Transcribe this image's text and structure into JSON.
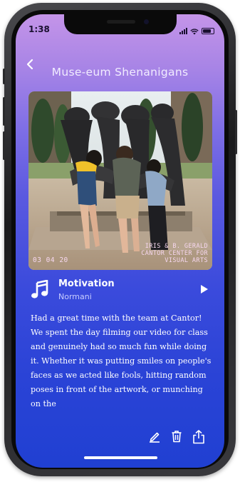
{
  "status_bar": {
    "time": "1:38",
    "signal_icon": "cellular-signal-icon",
    "wifi_icon": "wifi-icon",
    "battery_icon": "battery-icon"
  },
  "header": {
    "back_icon": "chevron-left-icon",
    "title": "Muse-eum Shenanigans"
  },
  "photo": {
    "date_stamp": "03 04 20",
    "caption_lines": [
      "IRIS & B. GERALD",
      "CANTOR CENTER FOR",
      "VISUAL ARTS"
    ]
  },
  "song": {
    "icon": "music-note-icon",
    "title": "Motivation",
    "artist": "Normani",
    "play_icon": "play-icon"
  },
  "entry_text": "Had a great time with the team at Cantor! We spent the day filming our video for class and genuinely had so much fun while doing it. Whether it was putting smiles on people's faces as we acted like fools, hitting random poses in front of the artwork, or munching on the",
  "actions": {
    "edit_icon": "pencil-icon",
    "delete_icon": "trash-icon",
    "share_icon": "share-icon"
  },
  "colors": {
    "gradient_top": "#c494e8",
    "gradient_bottom": "#2040d2",
    "text": "#ffffff",
    "artist_text": "#c8ccff",
    "stamp_text": "#f6d7ef"
  }
}
